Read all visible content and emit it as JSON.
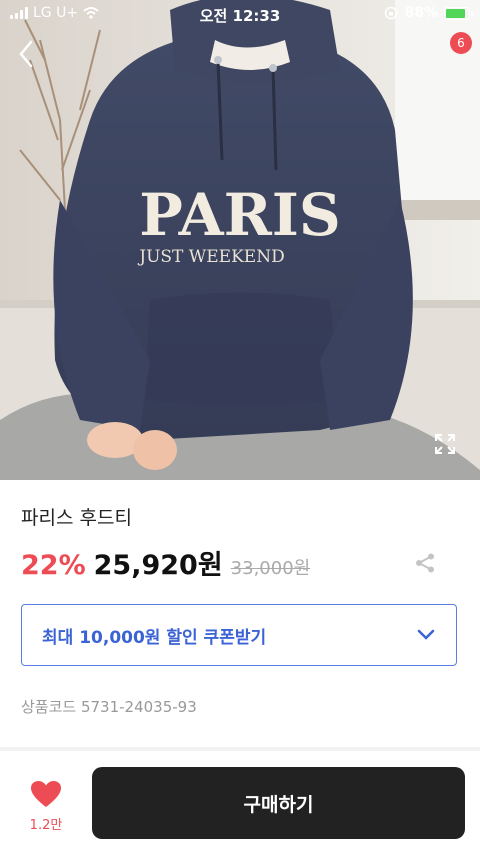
{
  "status_bar": {
    "carrier": "LG U+",
    "time": "오전 12:33",
    "battery": "88%"
  },
  "header": {
    "notification_count": "6"
  },
  "hero": {
    "graphic_text_1": "PARIS",
    "graphic_text_2": "JUST WEEKEND"
  },
  "product": {
    "name": "파리스 후드티",
    "discount": "22%",
    "price": "25,920원",
    "original_price": "33,000원",
    "coupon_label": "최대 10,000원 할인 쿠폰받기",
    "code": "상품코드 5731-24035-93"
  },
  "bottom": {
    "like_count": "1.2만",
    "buy_label": "구매하기"
  },
  "colors": {
    "accent_red": "#ee4c55",
    "coupon_blue": "#3b63d6",
    "buy_button": "#222222"
  }
}
